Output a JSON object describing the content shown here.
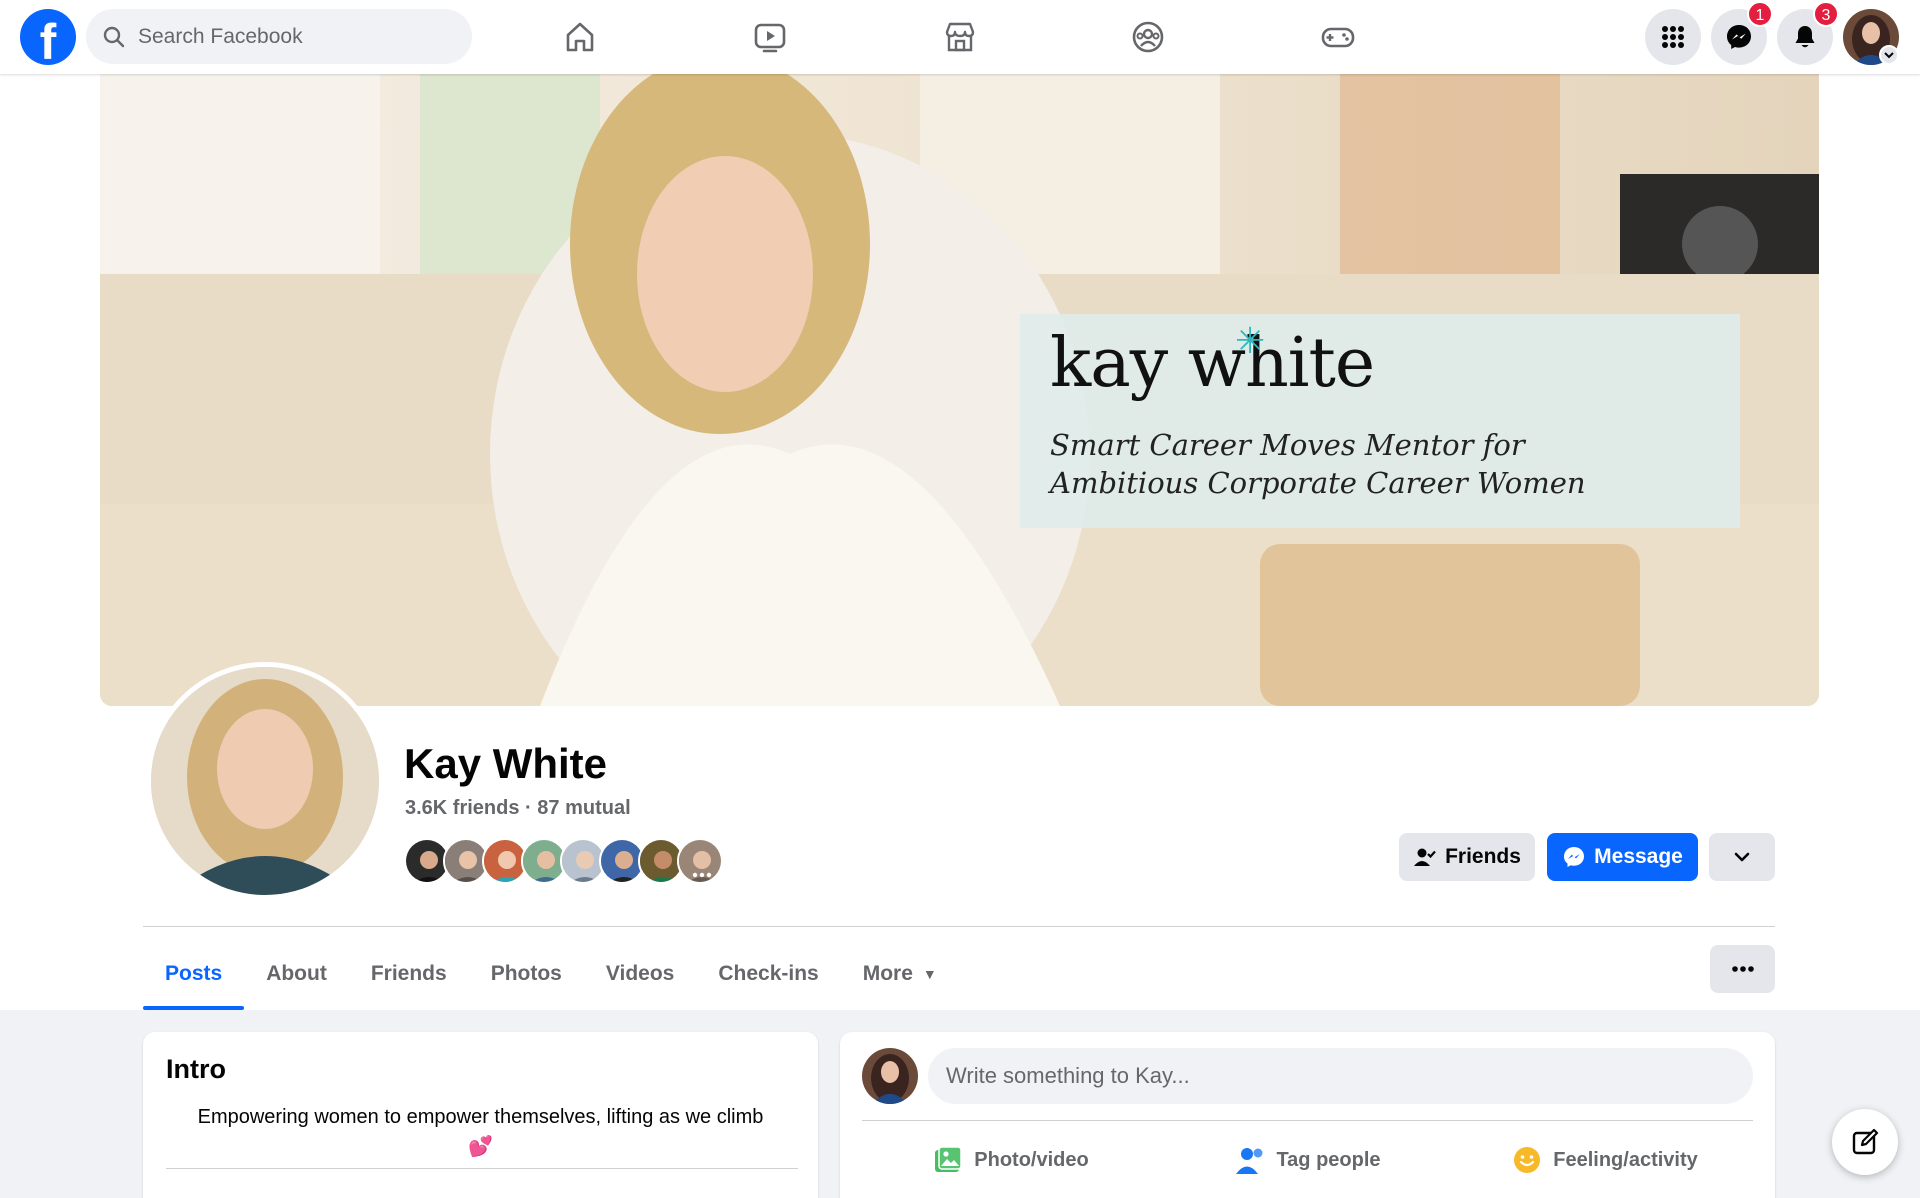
{
  "topbar": {
    "logo_letter": "f",
    "search_placeholder": "Search Facebook",
    "nav_icons": [
      "home-icon",
      "watch-icon",
      "marketplace-icon",
      "groups-icon",
      "gaming-icon"
    ],
    "messenger_badge": "1",
    "notifications_badge": "3"
  },
  "cover": {
    "brand_name": "kay white",
    "tagline_line1": "Smart Career Moves Mentor for",
    "tagline_line2": "Ambitious Corporate Career Women"
  },
  "profile": {
    "name": "Kay White",
    "friends_count": "3.6K friends",
    "separator": "·",
    "mutual_count": "87 mutual",
    "friends_button": "Friends",
    "message_button": "Message"
  },
  "tabs": [
    "Posts",
    "About",
    "Friends",
    "Photos",
    "Videos",
    "Check-ins",
    "More"
  ],
  "intro": {
    "title": "Intro",
    "bio": "Empowering women to empower themselves, lifting as we climb",
    "bio_emoji": "💕"
  },
  "composer": {
    "placeholder": "Write something to Kay...",
    "photo_video": "Photo/video",
    "tag_people": "Tag people",
    "feeling_activity": "Feeling/activity"
  },
  "colors": {
    "brand_blue": "#0866ff",
    "badge_red": "#e41e3f",
    "page_bg": "#f0f2f5"
  }
}
